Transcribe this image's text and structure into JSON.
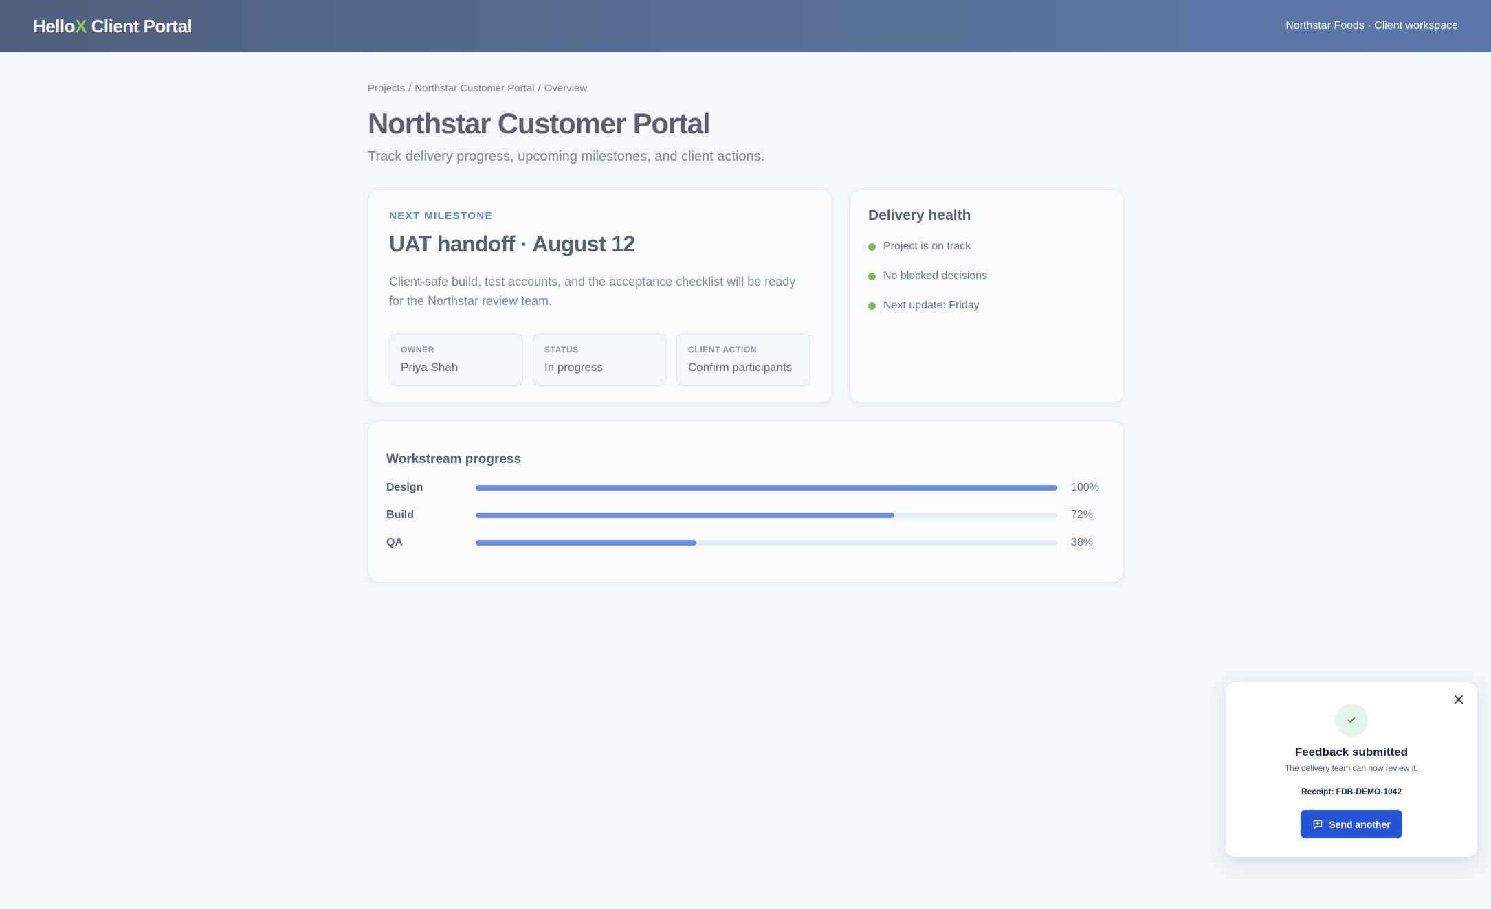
{
  "header": {
    "brand_prefix": "Hello",
    "brand_x": "X",
    "brand_suffix": " Client Portal",
    "workspace": "Northstar Foods · Client workspace"
  },
  "breadcrumb": [
    "Projects",
    "Northstar Customer Portal",
    "Overview"
  ],
  "page": {
    "title": "Northstar Customer Portal",
    "subtitle": "Track delivery progress, upcoming milestones, and client actions."
  },
  "milestone": {
    "eyebrow": "NEXT MILESTONE",
    "title": "UAT handoff · August 12",
    "description": "Client-safe build, test accounts, and the acceptance checklist will be ready for the Northstar review team.",
    "meta": [
      {
        "label": "OWNER",
        "value": "Priya Shah"
      },
      {
        "label": "STATUS",
        "value": "In progress"
      },
      {
        "label": "CLIENT ACTION",
        "value": "Confirm participants"
      }
    ]
  },
  "health": {
    "title": "Delivery health",
    "items": [
      "Project is on track",
      "No blocked decisions",
      "Next update: Friday"
    ],
    "dot_color": "#83b94b"
  },
  "progress": {
    "title": "Workstream progress",
    "rows": [
      {
        "label": "Design",
        "percent": 100,
        "percent_label": "100%"
      },
      {
        "label": "Build",
        "percent": 72,
        "percent_label": "72%"
      },
      {
        "label": "QA",
        "percent": 38,
        "percent_label": "38%"
      }
    ]
  },
  "toast": {
    "icon": "check-icon",
    "title": "Feedback submitted",
    "subtitle": "The delivery team can now review it.",
    "receipt": "Receipt: FDB-DEMO-1042",
    "button_label": "Send another",
    "button_icon": "message-plus-icon",
    "close_icon": "close-icon"
  },
  "colors": {
    "accent": "#2456d6",
    "progress_fill": "#6b8cdf",
    "brand_x": "#8fd04a",
    "eyebrow": "#5a85d6"
  }
}
